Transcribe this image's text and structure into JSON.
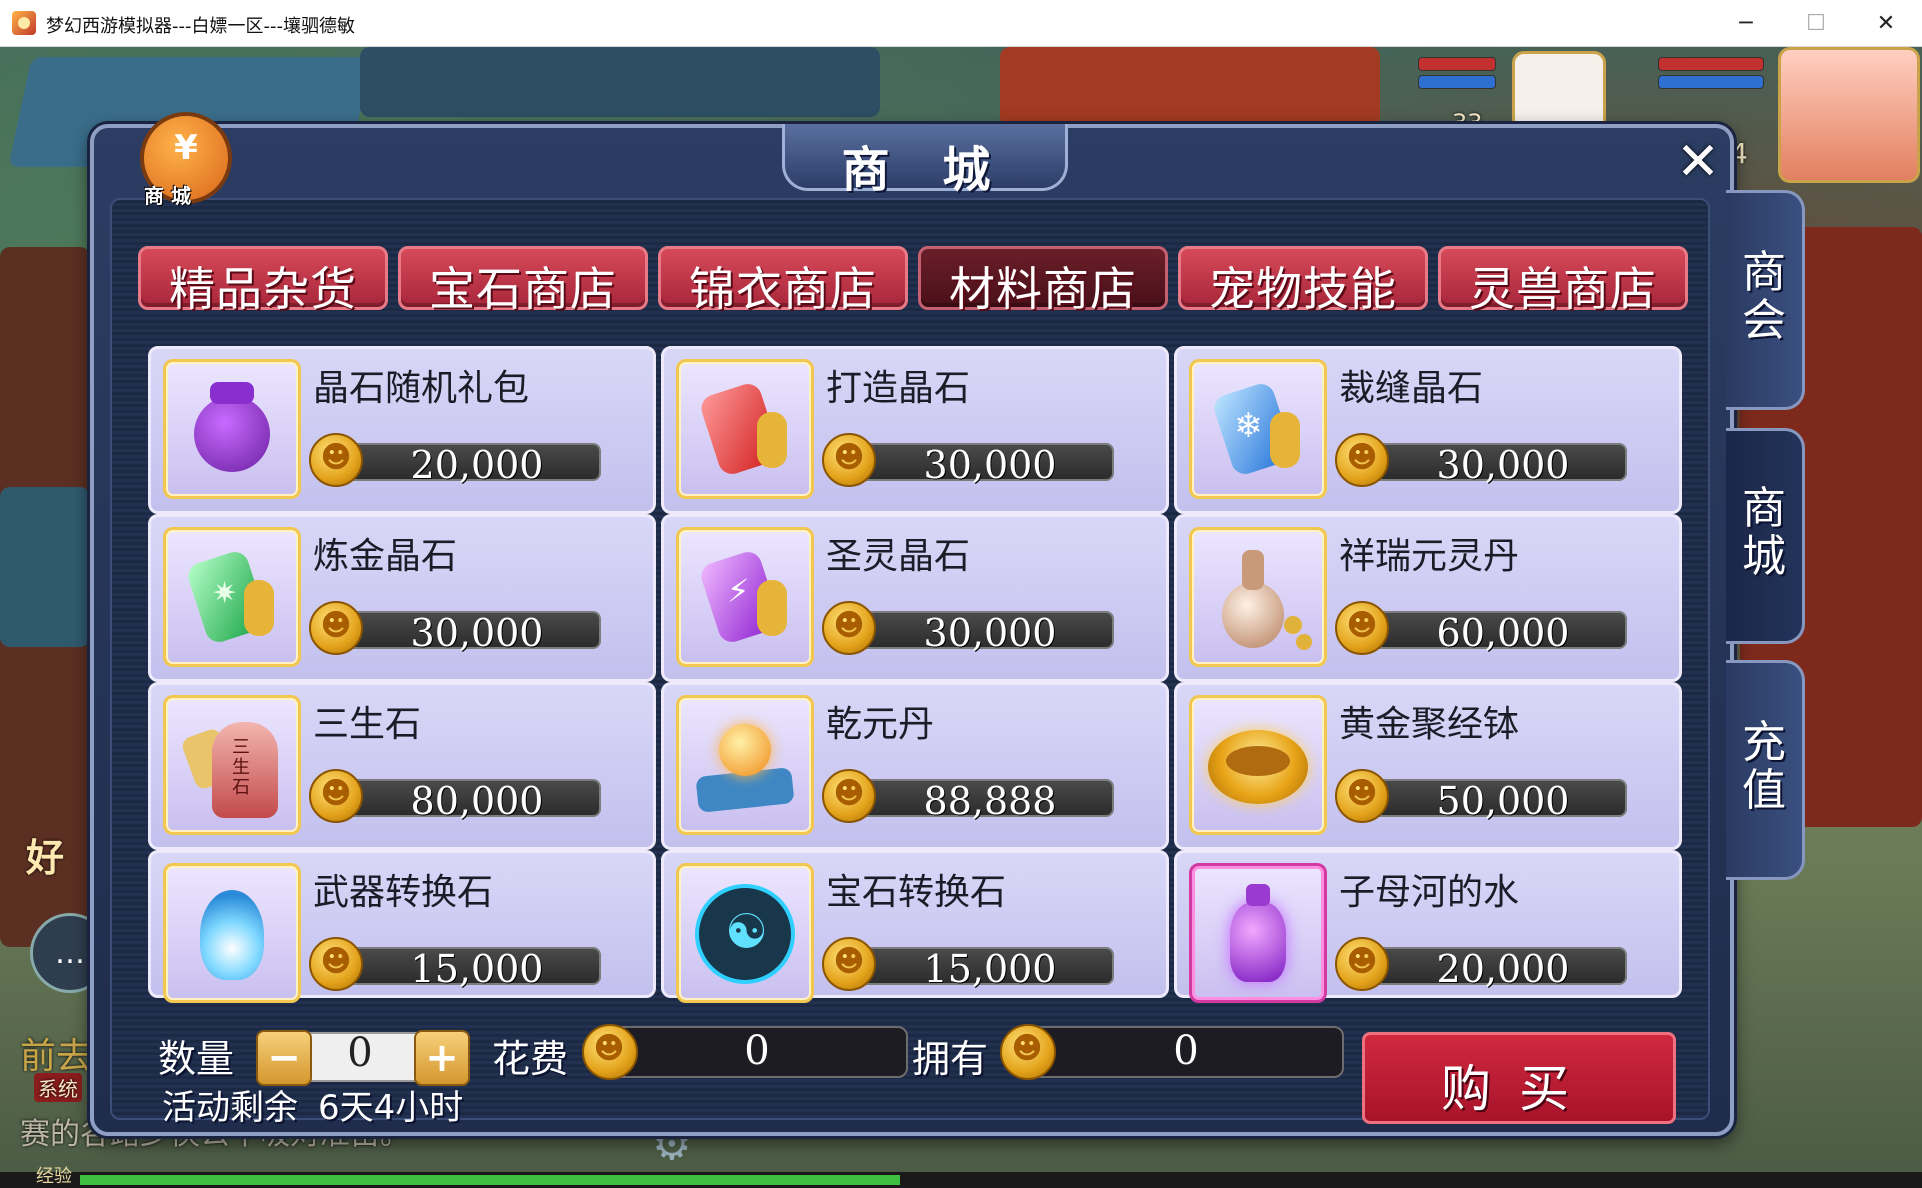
{
  "window": {
    "title": "梦幻西游模拟器---白嫖一区---壤驷德敏",
    "minimize_icon": "─",
    "maximize_icon": "☐",
    "close_icon": "✕"
  },
  "scene": {
    "left_label": "好",
    "left_label2": "前去",
    "system_tag": "系统",
    "chat_text": "赛的谷路少侠公平吸对准亩。",
    "exp_label": "经验",
    "level_partial": "33",
    "level_partial2": "4"
  },
  "shop": {
    "title": "商 城",
    "badge_label": "商 城",
    "badge_icon": "¥",
    "close_label": "✕",
    "tabs": [
      {
        "label": "精品杂货",
        "active": false
      },
      {
        "label": "宝石商店",
        "active": false
      },
      {
        "label": "锦衣商店",
        "active": false
      },
      {
        "label": "材料商店",
        "active": true
      },
      {
        "label": "宠物技能",
        "active": false
      },
      {
        "label": "灵兽商店",
        "active": false
      }
    ],
    "items": [
      {
        "name": "晶石随机礼包",
        "price": "20,000",
        "icon": "purple-pouch-icon"
      },
      {
        "name": "打造晶石",
        "price": "30,000",
        "icon": "red-crystal-icon"
      },
      {
        "name": "裁缝晶石",
        "price": "30,000",
        "icon": "blue-crystal-icon"
      },
      {
        "name": "炼金晶石",
        "price": "30,000",
        "icon": "green-crystal-icon"
      },
      {
        "name": "圣灵晶石",
        "price": "30,000",
        "icon": "purple-crystal-icon"
      },
      {
        "name": "祥瑞元灵丹",
        "price": "60,000",
        "icon": "gourd-bottle-icon"
      },
      {
        "name": "三生石",
        "price": "80,000",
        "icon": "sansheng-stone-icon"
      },
      {
        "name": "乾元丹",
        "price": "88,888",
        "icon": "glowing-pill-icon"
      },
      {
        "name": "黄金聚经钵",
        "price": "50,000",
        "icon": "golden-bowl-icon"
      },
      {
        "name": "武器转换石",
        "price": "15,000",
        "icon": "blue-flame-icon"
      },
      {
        "name": "宝石转换石",
        "price": "15,000",
        "icon": "yin-yang-icon"
      },
      {
        "name": "子母河的水",
        "price": "20,000",
        "icon": "purple-vase-icon"
      }
    ],
    "side_tabs": [
      {
        "label": "商会",
        "active": false
      },
      {
        "label": "商城",
        "active": true
      },
      {
        "label": "充值",
        "active": false
      }
    ],
    "bottom": {
      "quantity_label": "数量",
      "quantity_value": "0",
      "minus": "−",
      "plus": "+",
      "cost_label": "花费",
      "cost_value": "0",
      "owned_label": "拥有",
      "owned_value": "0",
      "remaining_label": "活动剩余",
      "remaining_value": "6天4小时",
      "buy_label": "购买"
    }
  },
  "colors": {
    "tab_red": "#c0344a",
    "tab_active": "#5a1822",
    "panel_blue": "#263658",
    "card_lavender": "#cfcdf3",
    "coin_gold": "#f0b83a"
  }
}
